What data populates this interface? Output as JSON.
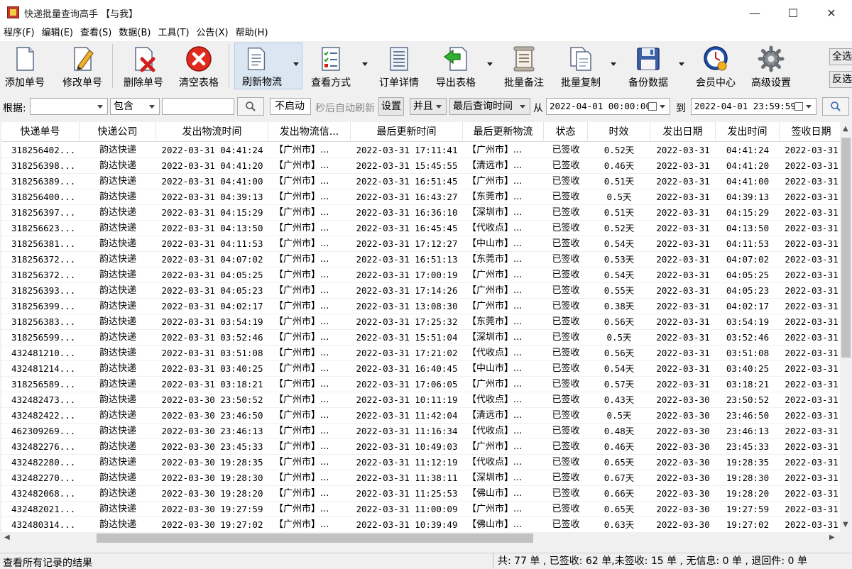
{
  "window": {
    "title": "快递批量查询高手 【与我】"
  },
  "menu": [
    "程序(F)",
    "编辑(E)",
    "查看(S)",
    "数据(B)",
    "工具(T)",
    "公告(X)",
    "帮助(H)"
  ],
  "toolbar": {
    "add": "添加单号",
    "edit": "修改单号",
    "delete": "删除单号",
    "clear": "清空表格",
    "refresh": "刷新物流",
    "view_mode": "查看方式",
    "order_detail": "订单详情",
    "export": "导出表格",
    "batch_note": "批量备注",
    "batch_copy": "批量复制",
    "backup": "备份数据",
    "member": "会员中心",
    "advanced": "高级设置",
    "select_all": "全选",
    "invert": "反选"
  },
  "filter": {
    "label": "根据:",
    "field_value": "",
    "match_value": "包含",
    "search_value": "",
    "auto_refresh_value": "不启动",
    "auto_refresh_suffix": "秒后自动刷新",
    "settings": "设置",
    "logic_value": "并且",
    "time_field_value": "最后查询时间",
    "from_label": "从",
    "from_value": "2022-04-01 00:00:00",
    "to_label": "到",
    "to_value": "2022-04-01 23:59:59"
  },
  "table": {
    "columns": [
      "快递单号",
      "快递公司",
      "发出物流时间",
      "发出物流信...",
      "最后更新时间",
      "最后更新物流",
      "状态",
      "时效",
      "发出日期",
      "发出时间",
      "签收日期"
    ],
    "rows": [
      [
        "318256402...",
        "韵达快递",
        "2022-03-31 04:41:24",
        "【广州市】...",
        "2022-03-31 17:11:41",
        "【广州市】...",
        "已签收",
        "0.52天",
        "2022-03-31",
        "04:41:24",
        "2022-03-31"
      ],
      [
        "318256398...",
        "韵达快递",
        "2022-03-31 04:41:20",
        "【广州市】...",
        "2022-03-31 15:45:55",
        "【清远市】...",
        "已签收",
        "0.46天",
        "2022-03-31",
        "04:41:20",
        "2022-03-31"
      ],
      [
        "318256389...",
        "韵达快递",
        "2022-03-31 04:41:00",
        "【广州市】...",
        "2022-03-31 16:51:45",
        "【广州市】...",
        "已签收",
        "0.51天",
        "2022-03-31",
        "04:41:00",
        "2022-03-31"
      ],
      [
        "318256400...",
        "韵达快递",
        "2022-03-31 04:39:13",
        "【广州市】...",
        "2022-03-31 16:43:27",
        "【东莞市】...",
        "已签收",
        "0.5天",
        "2022-03-31",
        "04:39:13",
        "2022-03-31"
      ],
      [
        "318256397...",
        "韵达快递",
        "2022-03-31 04:15:29",
        "【广州市】...",
        "2022-03-31 16:36:10",
        "【深圳市】...",
        "已签收",
        "0.51天",
        "2022-03-31",
        "04:15:29",
        "2022-03-31"
      ],
      [
        "318256623...",
        "韵达快递",
        "2022-03-31 04:13:50",
        "【广州市】...",
        "2022-03-31 16:45:45",
        "【代收点】...",
        "已签收",
        "0.52天",
        "2022-03-31",
        "04:13:50",
        "2022-03-31"
      ],
      [
        "318256381...",
        "韵达快递",
        "2022-03-31 04:11:53",
        "【广州市】...",
        "2022-03-31 17:12:27",
        "【中山市】...",
        "已签收",
        "0.54天",
        "2022-03-31",
        "04:11:53",
        "2022-03-31"
      ],
      [
        "318256372...",
        "韵达快递",
        "2022-03-31 04:07:02",
        "【广州市】...",
        "2022-03-31 16:51:13",
        "【东莞市】...",
        "已签收",
        "0.53天",
        "2022-03-31",
        "04:07:02",
        "2022-03-31"
      ],
      [
        "318256372...",
        "韵达快递",
        "2022-03-31 04:05:25",
        "【广州市】...",
        "2022-03-31 17:00:19",
        "【广州市】...",
        "已签收",
        "0.54天",
        "2022-03-31",
        "04:05:25",
        "2022-03-31"
      ],
      [
        "318256393...",
        "韵达快递",
        "2022-03-31 04:05:23",
        "【广州市】...",
        "2022-03-31 17:14:26",
        "【广州市】...",
        "已签收",
        "0.55天",
        "2022-03-31",
        "04:05:23",
        "2022-03-31"
      ],
      [
        "318256399...",
        "韵达快递",
        "2022-03-31 04:02:17",
        "【广州市】...",
        "2022-03-31 13:08:30",
        "【广州市】...",
        "已签收",
        "0.38天",
        "2022-03-31",
        "04:02:17",
        "2022-03-31"
      ],
      [
        "318256383...",
        "韵达快递",
        "2022-03-31 03:54:19",
        "【广州市】...",
        "2022-03-31 17:25:32",
        "【东莞市】...",
        "已签收",
        "0.56天",
        "2022-03-31",
        "03:54:19",
        "2022-03-31"
      ],
      [
        "318256599...",
        "韵达快递",
        "2022-03-31 03:52:46",
        "【广州市】...",
        "2022-03-31 15:51:04",
        "【深圳市】...",
        "已签收",
        "0.5天",
        "2022-03-31",
        "03:52:46",
        "2022-03-31"
      ],
      [
        "432481210...",
        "韵达快递",
        "2022-03-31 03:51:08",
        "【广州市】...",
        "2022-03-31 17:21:02",
        "【代收点】...",
        "已签收",
        "0.56天",
        "2022-03-31",
        "03:51:08",
        "2022-03-31"
      ],
      [
        "432481214...",
        "韵达快递",
        "2022-03-31 03:40:25",
        "【广州市】...",
        "2022-03-31 16:40:45",
        "【中山市】...",
        "已签收",
        "0.54天",
        "2022-03-31",
        "03:40:25",
        "2022-03-31"
      ],
      [
        "318256589...",
        "韵达快递",
        "2022-03-31 03:18:21",
        "【广州市】...",
        "2022-03-31 17:06:05",
        "【广州市】...",
        "已签收",
        "0.57天",
        "2022-03-31",
        "03:18:21",
        "2022-03-31"
      ],
      [
        "432482473...",
        "韵达快递",
        "2022-03-30 23:50:52",
        "【广州市】...",
        "2022-03-31 10:11:19",
        "【代收点】...",
        "已签收",
        "0.43天",
        "2022-03-30",
        "23:50:52",
        "2022-03-31"
      ],
      [
        "432482422...",
        "韵达快递",
        "2022-03-30 23:46:50",
        "【广州市】...",
        "2022-03-31 11:42:04",
        "【清远市】...",
        "已签收",
        "0.5天",
        "2022-03-30",
        "23:46:50",
        "2022-03-31"
      ],
      [
        "462309269...",
        "韵达快递",
        "2022-03-30 23:46:13",
        "【广州市】...",
        "2022-03-31 11:16:34",
        "【代收点】...",
        "已签收",
        "0.48天",
        "2022-03-30",
        "23:46:13",
        "2022-03-31"
      ],
      [
        "432482276...",
        "韵达快递",
        "2022-03-30 23:45:33",
        "【广州市】...",
        "2022-03-31 10:49:03",
        "【广州市】...",
        "已签收",
        "0.46天",
        "2022-03-30",
        "23:45:33",
        "2022-03-31"
      ],
      [
        "432482280...",
        "韵达快递",
        "2022-03-30 19:28:35",
        "【广州市】...",
        "2022-03-31 11:12:19",
        "【代收点】...",
        "已签收",
        "0.65天",
        "2022-03-30",
        "19:28:35",
        "2022-03-31"
      ],
      [
        "432482270...",
        "韵达快递",
        "2022-03-30 19:28:30",
        "【广州市】...",
        "2022-03-31 11:38:11",
        "【深圳市】...",
        "已签收",
        "0.67天",
        "2022-03-30",
        "19:28:30",
        "2022-03-31"
      ],
      [
        "432482068...",
        "韵达快递",
        "2022-03-30 19:28:20",
        "【广州市】...",
        "2022-03-31 11:25:53",
        "【佛山市】...",
        "已签收",
        "0.66天",
        "2022-03-30",
        "19:28:20",
        "2022-03-31"
      ],
      [
        "432482021...",
        "韵达快递",
        "2022-03-30 19:27:59",
        "【广州市】...",
        "2022-03-31 11:00:09",
        "【广州市】...",
        "已签收",
        "0.65天",
        "2022-03-30",
        "19:27:59",
        "2022-03-31"
      ],
      [
        "432480314...",
        "韵达快递",
        "2022-03-30 19:27:02",
        "【广州市】...",
        "2022-03-31 10:39:49",
        "【佛山市】...",
        "已签收",
        "0.63天",
        "2022-03-30",
        "19:27:02",
        "2022-03-31"
      ]
    ]
  },
  "status": {
    "left": "查看所有记录的结果",
    "right": "共: 77 单 , 已签收: 62 单,未签收: 15 单 , 无信息: 0 单 , 退回件: 0 单"
  }
}
